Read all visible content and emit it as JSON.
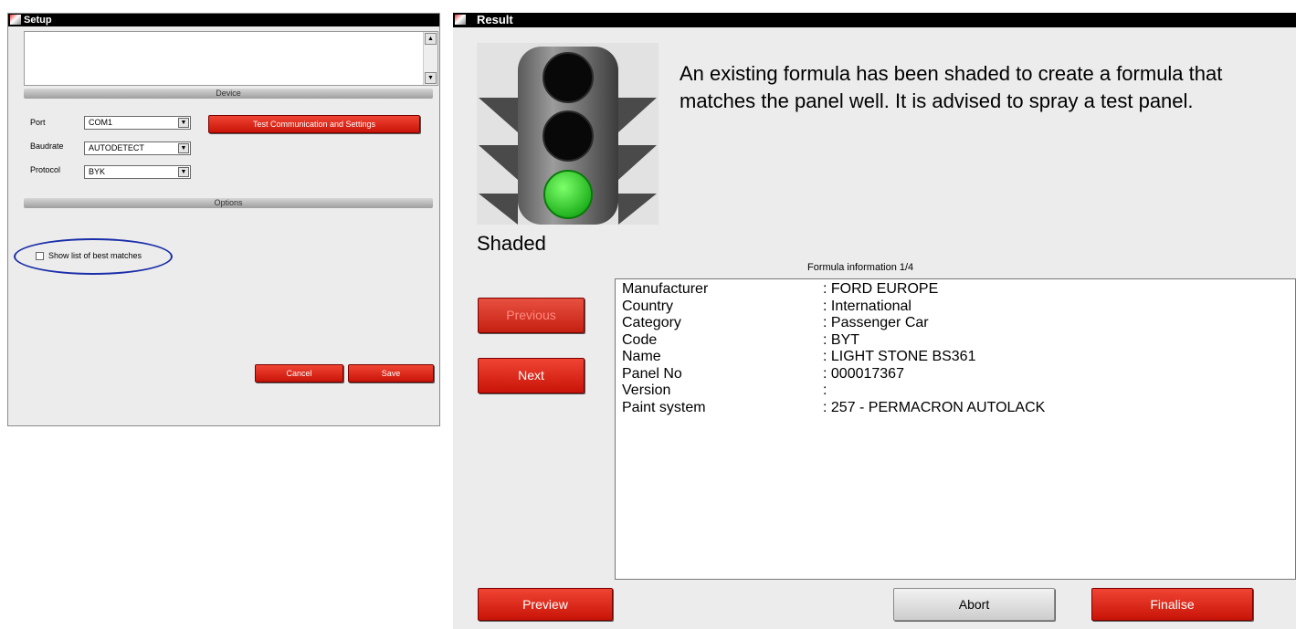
{
  "setup": {
    "title": "Setup",
    "device_section": "Device",
    "options_section": "Options",
    "port_label": "Port",
    "port_value": "COM1",
    "baudrate_label": "Baudrate",
    "baudrate_value": "AUTODETECT",
    "protocol_label": "Protocol",
    "protocol_value": "BYK",
    "test_button": "Test Communication and Settings",
    "show_best_matches_label": "Show list of best matches",
    "show_best_matches_checked": false,
    "cancel_button": "Cancel",
    "save_button": "Save"
  },
  "result": {
    "title": "Result",
    "message": "An existing formula has been shaded to create a formula that matches the panel well. It is advised to spray a test panel.",
    "status_label": "Shaded",
    "traffic_light_active": "green",
    "formula_header": "Formula information 1/4",
    "previous_button": "Previous",
    "next_button": "Next",
    "preview_button": "Preview",
    "abort_button": "Abort",
    "finalise_button": "Finalise",
    "formula_info": [
      {
        "key": "Manufacturer",
        "value": ": FORD EUROPE"
      },
      {
        "key": "Country",
        "value": ": International"
      },
      {
        "key": "Category",
        "value": ": Passenger Car"
      },
      {
        "key": "Code",
        "value": ": BYT"
      },
      {
        "key": "Name",
        "value": ": LIGHT STONE BS361"
      },
      {
        "key": "Panel No",
        "value": ": 000017367"
      },
      {
        "key": "Version",
        "value": ":"
      },
      {
        "key": "Paint system",
        "value": ": 257 - PERMACRON AUTOLACK"
      }
    ]
  },
  "colors": {
    "button_red": "#e0271a",
    "highlight_oval": "#1a2ea8",
    "light_green": "#2ecc2e"
  }
}
